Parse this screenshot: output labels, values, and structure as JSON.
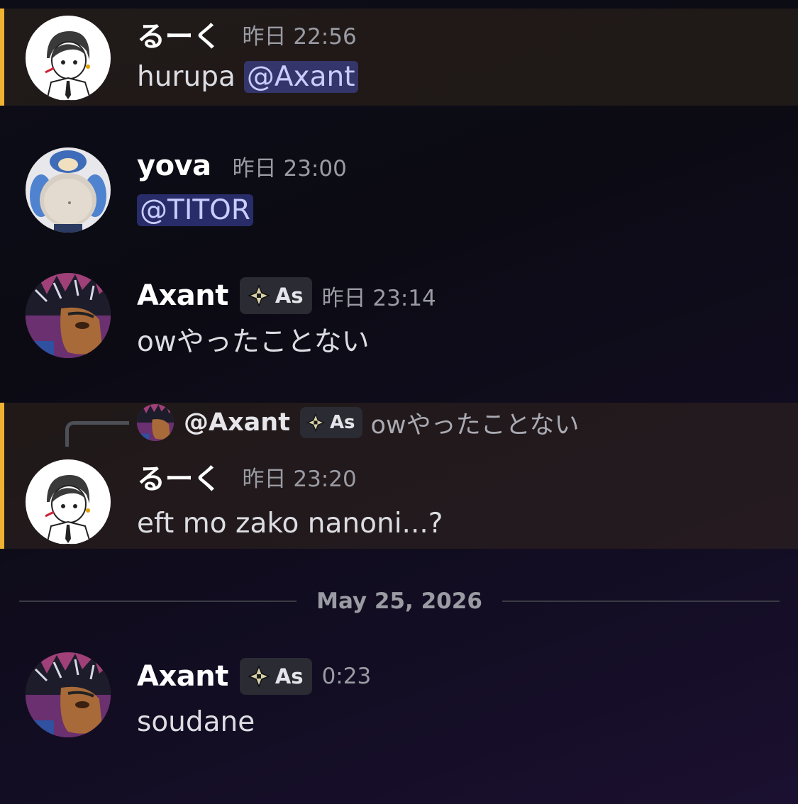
{
  "messages": [
    {
      "username": "るーく",
      "timestamp": "昨日 22:56",
      "text": "hurupa",
      "mention": "@Axant",
      "highlighted": true
    },
    {
      "username": "yova",
      "timestamp": "昨日 23:00",
      "mention": "@TITOR"
    },
    {
      "username": "Axant",
      "tag": "As",
      "timestamp": "昨日 23:14",
      "text": "owやったことない"
    },
    {
      "reply_to": {
        "username": "@Axant",
        "tag": "As",
        "text": "owやったことない"
      },
      "username": "るーく",
      "timestamp": "昨日 23:20",
      "text": "eft mo zako nanoni...?",
      "highlighted": true
    },
    {
      "username": "Axant",
      "tag": "As",
      "timestamp": "0:23",
      "text": "soudane"
    }
  ],
  "date_divider": "May 25, 2026",
  "colors": {
    "highlight_bar": "#f0b232",
    "mention_bg": "#5865f2",
    "mention_text": "#c9cdff",
    "timestamp": "#9a9ba3"
  }
}
